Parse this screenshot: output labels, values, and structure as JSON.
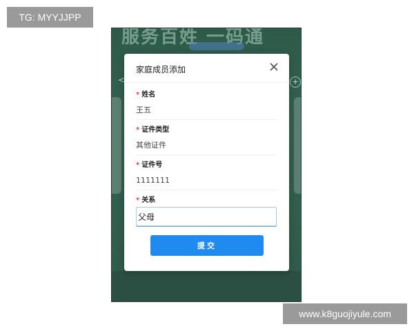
{
  "watermarks": {
    "top_left": "TG: MYYJJPP",
    "bottom_right": "www.k8guojiyule.com"
  },
  "background": {
    "banner_text": "服务百姓 一码通"
  },
  "modal": {
    "title": "家庭成员添加",
    "close_icon": "close-icon",
    "fields": [
      {
        "label": "姓名",
        "value": "王五",
        "required": true
      },
      {
        "label": "证件类型",
        "value": "其他证件",
        "required": true
      },
      {
        "label": "证件号",
        "value": "1111111",
        "required": true
      },
      {
        "label": "关系",
        "value": "父母",
        "required": true
      }
    ],
    "submit_label": "提交"
  },
  "colors": {
    "accent": "#1f8bf0",
    "required": "#e64545",
    "background": "#2e5a4a"
  }
}
